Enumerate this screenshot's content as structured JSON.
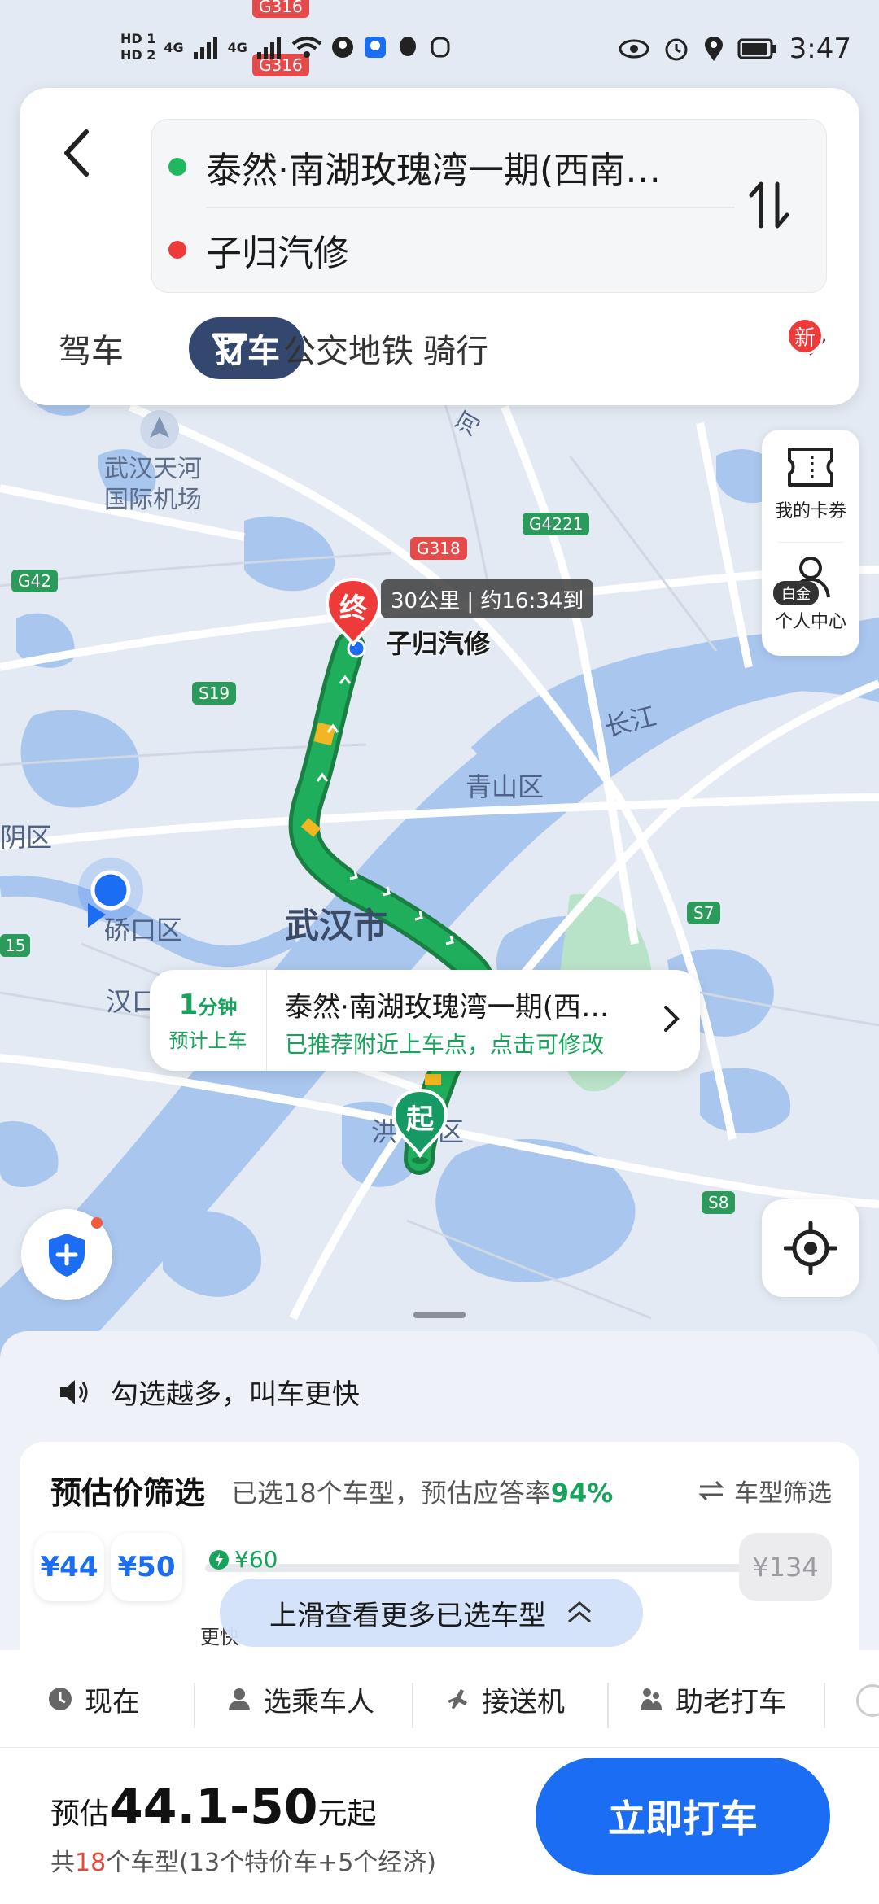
{
  "status_bar": {
    "time": "3:47",
    "hd1": "HD 1",
    "hd2": "HD 2",
    "net1": "4G",
    "net2": "4G"
  },
  "header": {
    "origin": "泰然·南湖玫瑰湾一期(西南…",
    "destination": "子归汽修",
    "tabs": [
      {
        "label": "驾车"
      },
      {
        "label": "打车"
      },
      {
        "label": "公交地铁"
      },
      {
        "label": "骑行"
      }
    ],
    "new_badge": "新"
  },
  "side": {
    "coupon_label": "我的卡券",
    "profile_label": "个人中心",
    "gold_tag": "白金"
  },
  "map": {
    "labels": {
      "airport": "武汉天河\n国际机场",
      "airport_line1": "武汉天河",
      "airport_line2": "国际机场",
      "qingshan": "青山区",
      "wuhan": "武汉市",
      "qiaokou": "硚口区",
      "hankou": "汉口",
      "changjiang": "长江",
      "hongshan_partial": "洪",
      "hongshan_partial2": "区",
      "left_partial": "阴区",
      "road_g316": "G316",
      "road_g318": "G318",
      "road_g4221": "G4221",
      "road_g42": "G42",
      "road_s19": "S19",
      "road_s7": "S7",
      "road_s8": "S8",
      "road_15": "15",
      "river": "河"
    },
    "dest_marker": "终",
    "start_marker": "起",
    "dest_name": "子归汽修",
    "route_info": "30公里 | 约16:34到"
  },
  "pickup": {
    "minutes": "1",
    "minutes_unit": "分钟",
    "eta_label": "预计上车",
    "place": "泰然·南湖玫瑰湾一期(西…",
    "hint": "已推荐附近上车点，点击可修改"
  },
  "sheet": {
    "tip": "勾选越多，叫车更快",
    "filter_title": "预估价筛选",
    "filter_sub_prefix": "已选18个车型，预估应答率",
    "answer_rate": "94%",
    "filter_btn": "车型筛选",
    "prices": [
      "¥44",
      "¥50",
      "¥60",
      "¥134"
    ],
    "cheaper": "更快",
    "slide_tip": "上滑查看更多已选车型"
  },
  "options": [
    {
      "label": "现在"
    },
    {
      "label": "选乘车人"
    },
    {
      "label": "接送机"
    },
    {
      "label": "助老打车"
    }
  ],
  "estimate": {
    "prefix": "预估",
    "range": "44.1-50",
    "suffix": "元起",
    "detail_pre": "共",
    "count": "18",
    "detail_post": "个车型(13个特价车+5个经济)"
  },
  "call_button": "立即打车",
  "colors": {
    "primary": "#1b6ef3",
    "green": "#18a35c",
    "route_green": "#1fae5b",
    "dest_red": "#ef3a3a",
    "tab_active": "#34476e",
    "river": "#a9c6ee"
  }
}
